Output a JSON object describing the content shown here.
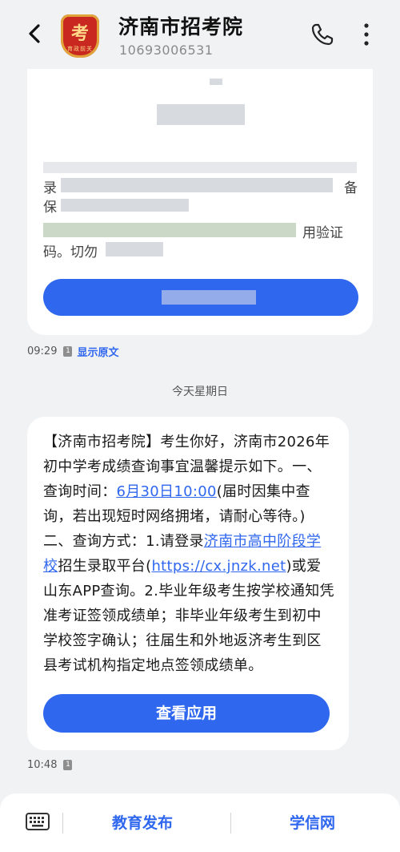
{
  "header": {
    "title": "济南市招考院",
    "phone": "10693006531",
    "avatar_text": "考",
    "avatar_tag": "育政前关"
  },
  "message1": {
    "fragment_1": "录",
    "fragment_2": "备",
    "fragment_3": "保",
    "fragment_4": "用验证",
    "fragment_5": "码。切勿",
    "time": "09:29",
    "sim": "1",
    "show_original": "显示原文"
  },
  "day_separator": "今天星期日",
  "message2": {
    "text_1": "【济南市招考院】考生你好，济南市2026年初中学考成绩查询事宜温馨提示如下。一、查询时间：",
    "link_time": "6月30日10:00",
    "text_2": "(届时因集中查询，若出现短时网络拥堵，请耐心等待。)二、查询方式：1.请登录",
    "link_platform": "济南市高中阶段学校",
    "text_3": "招生录取平台(",
    "link_url": "https://cx.jnzk.net",
    "text_4": ")或爱山东APP查询。2.毕业年级考生按学校通知凭准考证签领成绩单；非毕业年级考生到初中学校签字确认；往届生和外地返济考生到区县考试机构指定地点签领成绩单。",
    "button": "查看应用",
    "time": "10:48",
    "sim": "1"
  },
  "bottom_bar": {
    "menu_1": "教育发布",
    "menu_2": "学信网"
  },
  "colors": {
    "accent": "#2f67ee",
    "background": "#f1f2f4",
    "avatar_red": "#c8281f"
  }
}
